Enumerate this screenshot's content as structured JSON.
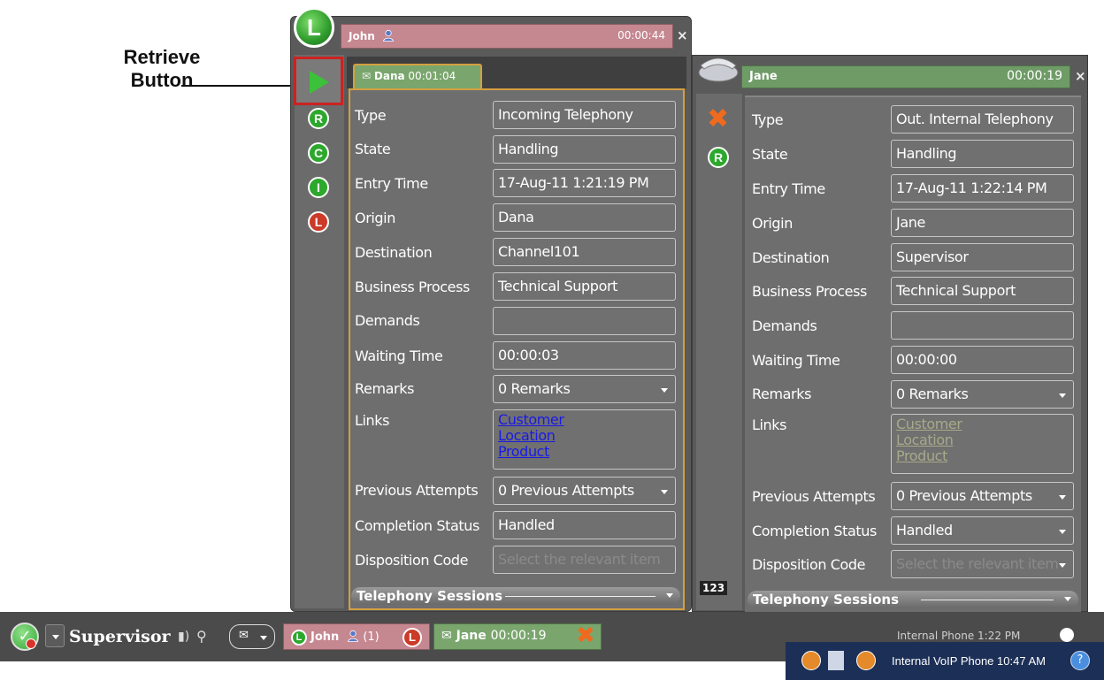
{
  "annotation": {
    "line1": "Retrieve",
    "line2": "Button"
  },
  "left_window": {
    "caller_name": "John",
    "call_timer": "00:00:44",
    "close": "×",
    "badge_letter": "L",
    "tab": {
      "name": "Dana",
      "timer": "00:01:04"
    },
    "sidebar_buttons": [
      "R",
      "C",
      "I",
      "L"
    ],
    "fields": {
      "type": {
        "label": "Type",
        "value": "Incoming Telephony"
      },
      "state": {
        "label": "State",
        "value": "Handling"
      },
      "entry_time": {
        "label": "Entry Time",
        "value": "17-Aug-11 1:21:19 PM"
      },
      "origin": {
        "label": "Origin",
        "value": "Dana"
      },
      "destination": {
        "label": "Destination",
        "value": "Channel101"
      },
      "business_process": {
        "label": "Business Process",
        "value": "Technical Support"
      },
      "demands": {
        "label": "Demands",
        "value": ""
      },
      "waiting_time": {
        "label": "Waiting Time",
        "value": "00:00:03"
      },
      "remarks": {
        "label": "Remarks",
        "value": "0 Remarks"
      },
      "links": {
        "label": "Links",
        "items": [
          "Customer",
          "Location",
          "Product"
        ]
      },
      "previous_attempts": {
        "label": "Previous Attempts",
        "value": "0 Previous Attempts"
      },
      "completion_status": {
        "label": "Completion Status",
        "value": "Handled"
      },
      "disposition_code": {
        "label": "Disposition Code",
        "placeholder": "Select the relevant item"
      }
    },
    "sessions_label": "Telephony Sessions"
  },
  "right_window": {
    "caller_name": "Jane",
    "call_timer": "00:00:19",
    "close": "×",
    "sidebar_buttons": [
      "R"
    ],
    "keypad_label": "123",
    "fields": {
      "type": {
        "label": "Type",
        "value": "Out. Internal Telephony"
      },
      "state": {
        "label": "State",
        "value": "Handling"
      },
      "entry_time": {
        "label": "Entry Time",
        "value": "17-Aug-11 1:22:14 PM"
      },
      "origin": {
        "label": "Origin",
        "value": "Jane"
      },
      "destination": {
        "label": "Destination",
        "value": "Supervisor"
      },
      "business_process": {
        "label": "Business Process",
        "value": "Technical Support"
      },
      "demands": {
        "label": "Demands",
        "value": ""
      },
      "waiting_time": {
        "label": "Waiting Time",
        "value": "00:00:00"
      },
      "remarks": {
        "label": "Remarks",
        "value": "0 Remarks"
      },
      "links": {
        "label": "Links",
        "items": [
          "Customer",
          "Location",
          "Product"
        ]
      },
      "previous_attempts": {
        "label": "Previous Attempts",
        "value": "0 Previous Attempts"
      },
      "completion_status": {
        "label": "Completion Status",
        "value": "Handled"
      },
      "disposition_code": {
        "label": "Disposition Code",
        "placeholder": "Select the relevant item"
      }
    },
    "sessions_label": "Telephony Sessions"
  },
  "taskbar": {
    "user": "Supervisor",
    "john_item": {
      "letter": "L",
      "name": "John",
      "count": "(1)"
    },
    "jane_item": {
      "name": "Jane",
      "timer": "00:00:19"
    },
    "internal_phone": "Internal Phone   1:22 PM",
    "tray_text": "Internal VoIP Phone  10:47 AM",
    "help": "?"
  },
  "colors": {
    "window_bg": "#5a5a5a",
    "john_header": "#c58790",
    "jane_header": "#6f9c66",
    "active_border": "#d4a040",
    "retrieve_highlight": "#cc2222",
    "link_active": "#1a1ae6",
    "link_disabled": "#a7a98a"
  }
}
